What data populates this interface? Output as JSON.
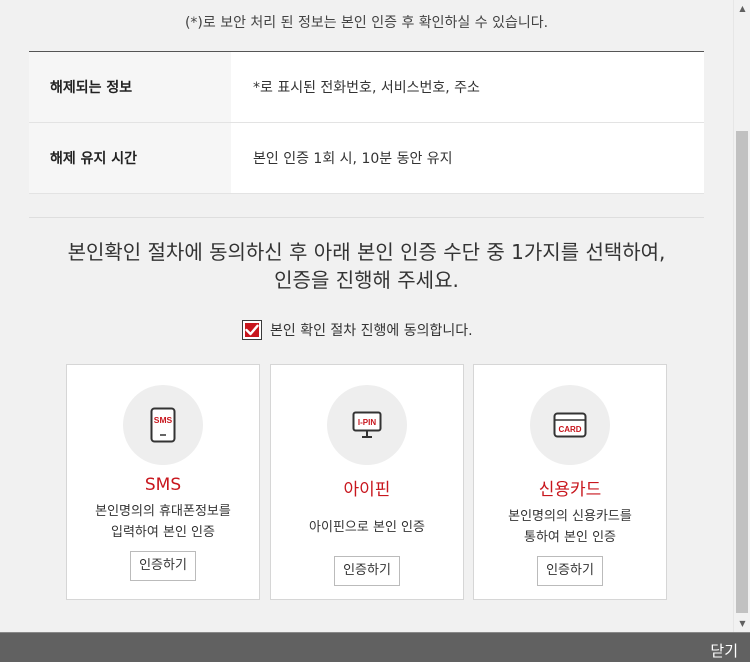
{
  "notice": "(*)로 보안 처리 된 정보는 본인 인증 후 확인하실 수 있습니다.",
  "info_rows": [
    {
      "label": "해제되는 정보",
      "value": "*로 표시된 전화번호, 서비스번호, 주소"
    },
    {
      "label": "해제 유지 시간",
      "value": "본인 인증 1회 시, 10분 동안 유지"
    }
  ],
  "headline_line1": "본인확인 절차에 동의하신 후 아래 본인 인증 수단 중 1가지를 선택하여,",
  "headline_line2": "인증을 진행해 주세요.",
  "agree_label": "본인 확인 절차 진행에 동의합니다.",
  "agree_checked": true,
  "methods": [
    {
      "icon": "sms-phone-icon",
      "icon_text": "SMS",
      "title": "SMS",
      "desc1": "본인명의의 휴대폰정보를",
      "desc2": "입력하여 본인 인증",
      "button": "인증하기"
    },
    {
      "icon": "ipin-monitor-icon",
      "icon_text": "I-PIN",
      "title": "아이핀",
      "desc1": "아이핀으로 본인 인증",
      "desc2": "",
      "button": "인증하기"
    },
    {
      "icon": "credit-card-icon",
      "icon_text": "CARD",
      "title": "신용카드",
      "desc1": "본인명의의 신용카드를",
      "desc2": "통하여 본인 인증",
      "button": "인증하기"
    }
  ],
  "footer_close": "닫기",
  "colors": {
    "accent": "#c8161d",
    "footer": "#616161"
  }
}
